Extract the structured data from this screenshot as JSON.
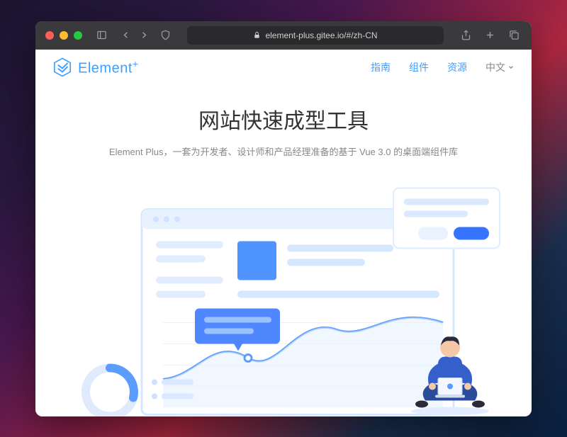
{
  "browser": {
    "url": "element-plus.gitee.io/#/zh-CN"
  },
  "logo": {
    "text": "Element",
    "suffix": "+"
  },
  "nav": {
    "guide": "指南",
    "components": "组件",
    "resources": "资源",
    "lang": "中文"
  },
  "hero": {
    "title": "网站快速成型工具",
    "subtitle": "Element Plus，一套为开发者、设计师和产品经理准备的基于 Vue 3.0 的桌面端组件库"
  }
}
